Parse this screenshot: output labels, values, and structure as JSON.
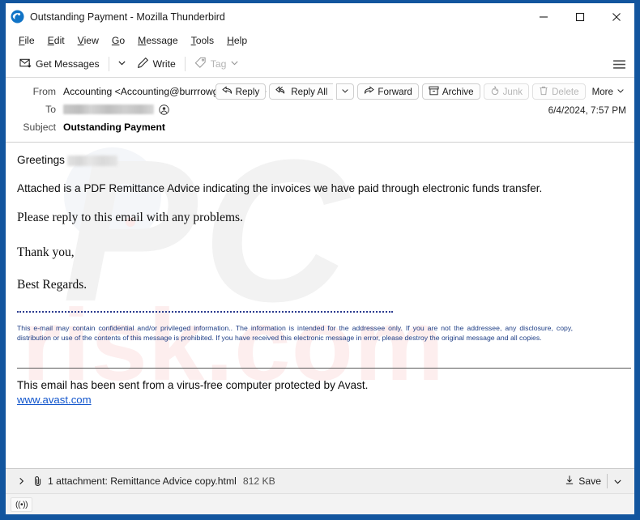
{
  "window": {
    "title": "Outstanding Payment - Mozilla Thunderbird",
    "logo_icon": "thunderbird-logo-icon",
    "minimize_icon": "minimize-icon",
    "maximize_icon": "maximize-icon",
    "close_icon": "close-icon"
  },
  "menubar": {
    "items": [
      {
        "label": "File",
        "accel": "F"
      },
      {
        "label": "Edit",
        "accel": "E"
      },
      {
        "label": "View",
        "accel": "V"
      },
      {
        "label": "Go",
        "accel": "G"
      },
      {
        "label": "Message",
        "accel": "M"
      },
      {
        "label": "Tools",
        "accel": "T"
      },
      {
        "label": "Help",
        "accel": "H"
      }
    ]
  },
  "toolbar": {
    "get_messages_label": "Get Messages",
    "get_messages_icon": "inbox-download-icon",
    "get_messages_chevron_icon": "chevron-down-icon",
    "write_label": "Write",
    "write_icon": "pencil-icon",
    "tag_label": "Tag",
    "tag_icon": "tag-icon",
    "tag_chevron_icon": "chevron-down-icon",
    "tag_disabled": true,
    "app_menu_icon": "hamburger-menu-icon"
  },
  "message_header": {
    "from_label": "From",
    "from_value": "Accounting <Accounting@burrrowglobal.com>",
    "from_avatar_icon": "contact-avatar-icon",
    "to_label": "To",
    "to_value_redacted": true,
    "to_avatar_icon": "contact-avatar-icon",
    "subject_label": "Subject",
    "subject_value": "Outstanding Payment",
    "date": "6/4/2024, 7:57 PM",
    "actions": [
      {
        "label": "Reply",
        "icon": "reply-icon",
        "disabled": false
      },
      {
        "label": "Reply All",
        "icon": "reply-all-icon",
        "disabled": false
      },
      {
        "label": "Forward",
        "icon": "forward-icon",
        "disabled": false
      },
      {
        "label": "Archive",
        "icon": "archive-box-icon",
        "disabled": false
      },
      {
        "label": "Junk",
        "icon": "junk-flame-icon",
        "disabled": true
      },
      {
        "label": "Delete",
        "icon": "trash-icon",
        "disabled": true
      },
      {
        "label": "More",
        "icon": "chevron-down-icon",
        "disabled": false
      }
    ],
    "reply_all_chevron_icon": "chevron-down-icon"
  },
  "body": {
    "greeting": "Greetings",
    "greeting_redacted": true,
    "paragraph_1": "Attached is a PDF Remittance Advice indicating the invoices we have paid through electronic funds transfer.",
    "paragraph_2": "Please reply to this email with any problems.",
    "closing_1": "Thank you,",
    "closing_2": "Best Regards.",
    "disclaimer": "This e-mail may contain confidential and/or privileged information.. The information is intended for the addressee only. If you are not the addressee, any disclosure, copy, distribution or use of the contents of this message is prohibited. If you have received this electronic message in error, please destroy the original message and all copies.",
    "avast_notice": "This email has been sent from a virus-free computer protected by Avast.",
    "avast_link": "www.avast.com",
    "watermark_primary": "PC",
    "watermark_secondary": "risk.com"
  },
  "attachment_bar": {
    "expand_icon": "chevron-right-icon",
    "clip_icon": "paperclip-icon",
    "summary": "1 attachment: Remittance Advice copy.html",
    "size": "812 KB",
    "save_label": "Save",
    "save_icon": "download-icon",
    "save_chevron_icon": "chevron-down-icon"
  },
  "status_bar": {
    "connection_icon": "broadcast-icon",
    "connection_glyph": "((•))"
  },
  "colors": {
    "window_border": "#12559e",
    "link": "#1155cc",
    "disclaimer_text": "#1f3f86",
    "disabled_text": "#b6b6b6"
  }
}
